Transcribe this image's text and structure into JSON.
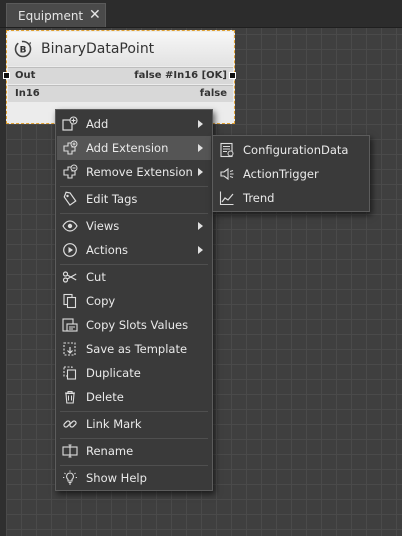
{
  "tab": {
    "label": "Equipment",
    "close_glyph": "✕"
  },
  "node": {
    "title": "BinaryDataPoint",
    "slots": [
      {
        "name": "Out",
        "value": "false #In16 [OK]"
      },
      {
        "name": "In16",
        "value": "false"
      }
    ]
  },
  "context_menu": {
    "items": [
      {
        "label": "Add",
        "icon": "add-icon",
        "submenu": true
      },
      {
        "label": "Add Extension",
        "icon": "add-extension-icon",
        "submenu": true,
        "active": true
      },
      {
        "label": "Remove Extension",
        "icon": "remove-extension-icon",
        "submenu": true
      },
      {
        "label": "Edit Tags",
        "icon": "tag-icon",
        "submenu": false
      },
      {
        "label": "Views",
        "icon": "eye-icon",
        "submenu": true
      },
      {
        "label": "Actions",
        "icon": "play-icon",
        "submenu": true
      },
      {
        "label": "Cut",
        "icon": "scissors-icon",
        "submenu": false
      },
      {
        "label": "Copy",
        "icon": "copy-icon",
        "submenu": false
      },
      {
        "label": "Copy Slots Values",
        "icon": "copy-slots-icon",
        "submenu": false
      },
      {
        "label": "Save as Template",
        "icon": "template-icon",
        "submenu": false
      },
      {
        "label": "Duplicate",
        "icon": "duplicate-icon",
        "submenu": false
      },
      {
        "label": "Delete",
        "icon": "trash-icon",
        "submenu": false
      },
      {
        "label": "Link Mark",
        "icon": "link-icon",
        "submenu": false
      },
      {
        "label": "Rename",
        "icon": "rename-icon",
        "submenu": false
      },
      {
        "label": "Show Help",
        "icon": "lightbulb-icon",
        "submenu": false
      }
    ]
  },
  "submenu": {
    "items": [
      {
        "label": "ConfigurationData",
        "icon": "configuration-data-icon"
      },
      {
        "label": "ActionTrigger",
        "icon": "action-trigger-icon"
      },
      {
        "label": "Trend",
        "icon": "trend-icon"
      }
    ]
  }
}
